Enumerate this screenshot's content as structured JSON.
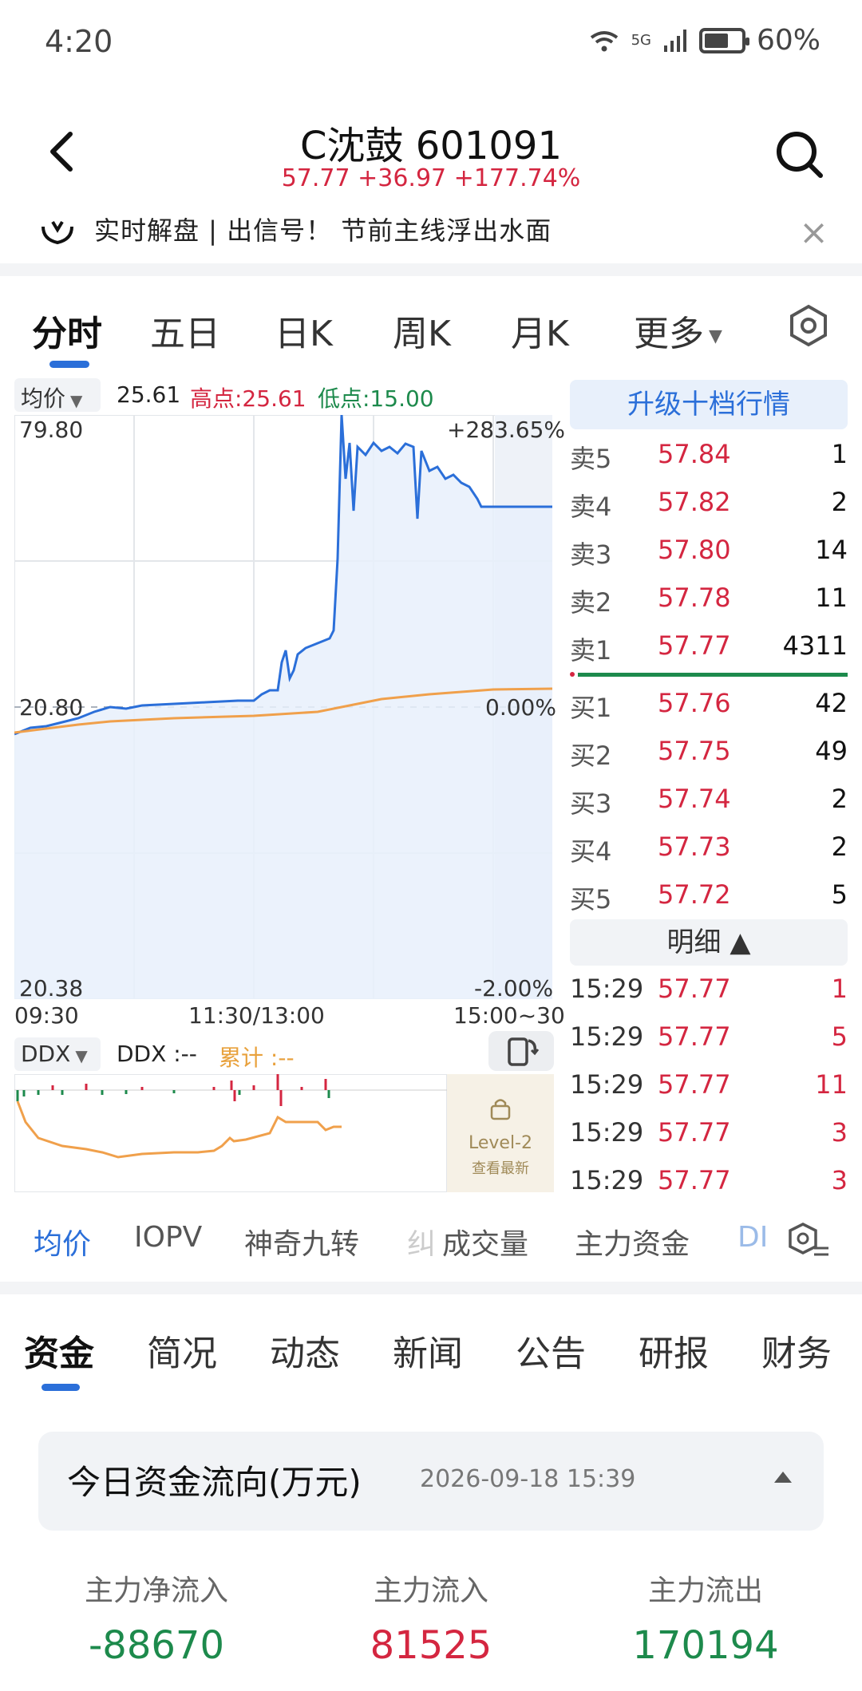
{
  "status": {
    "time": "4:20",
    "network": "5G",
    "battery": "60%"
  },
  "header": {
    "title": "C沈鼓 601091",
    "quote": "57.77 +36.97 +177.74%"
  },
  "banner": {
    "text": "实时解盘 | 出信号！ 节前主线浮出水面",
    "close": "×"
  },
  "period_tabs": [
    "分时",
    "五日",
    "日K",
    "周K",
    "月K",
    "更多"
  ],
  "price_panel": {
    "avg_label": "均价",
    "avg_value": "25.61",
    "high": "高点:25.61",
    "low": "低点:15.00",
    "axis_top_left": "79.80",
    "axis_top_right": "+283.65%",
    "axis_mid_left": "20.80",
    "axis_mid_right": "0.00%",
    "axis_bot_left": "20.38",
    "axis_bot_right": "-2.00%",
    "time_start": "09:30",
    "time_mid": "11:30/13:00",
    "time_end": "15:00~30"
  },
  "ddx_panel": {
    "label": "DDX",
    "value": "DDX :--",
    "cumulative": "累计 :--",
    "level2_title": "Level-2",
    "level2_sub": "查看最新"
  },
  "order_book": {
    "upgrade_label": "升级十档行情",
    "asks": [
      {
        "label": "卖5",
        "price": "57.84",
        "volume": "1"
      },
      {
        "label": "卖4",
        "price": "57.82",
        "volume": "2"
      },
      {
        "label": "卖3",
        "price": "57.80",
        "volume": "14"
      },
      {
        "label": "卖2",
        "price": "57.78",
        "volume": "11"
      },
      {
        "label": "卖1",
        "price": "57.77",
        "volume": "4311"
      }
    ],
    "bids": [
      {
        "label": "买1",
        "price": "57.76",
        "volume": "42"
      },
      {
        "label": "买2",
        "price": "57.75",
        "volume": "49"
      },
      {
        "label": "买3",
        "price": "57.74",
        "volume": "2"
      },
      {
        "label": "买4",
        "price": "57.73",
        "volume": "2"
      },
      {
        "label": "买5",
        "price": "57.72",
        "volume": "5"
      }
    ],
    "detail_label": "明细 ▲",
    "ticks": [
      {
        "time": "15:29",
        "price": "57.77",
        "volume": "1"
      },
      {
        "time": "15:29",
        "price": "57.77",
        "volume": "5"
      },
      {
        "time": "15:29",
        "price": "57.77",
        "volume": "11"
      },
      {
        "time": "15:29",
        "price": "57.77",
        "volume": "3"
      },
      {
        "time": "15:29",
        "price": "57.77",
        "volume": "3"
      }
    ]
  },
  "indicator_tabs": [
    "均价",
    "IOPV",
    "神奇九转",
    "纠",
    "成交量",
    "主力资金",
    "DI"
  ],
  "lower_tabs": [
    "资金",
    "简况",
    "动态",
    "新闻",
    "公告",
    "研报",
    "财务"
  ],
  "fund_flow": {
    "title": "今日资金流向(万元)",
    "timestamp": "2026-09-18 15:39",
    "columns": [
      {
        "label": "主力净流入",
        "value": "-88670"
      },
      {
        "label": "主力流入",
        "value": "81525"
      },
      {
        "label": "主力流出",
        "value": "170194"
      }
    ]
  },
  "colors": {
    "up": "#d42640",
    "down": "#1d8a4c",
    "accent": "#2b6fd9",
    "avg_line": "#f0a04b"
  },
  "icons": [
    "back-arrow-icon",
    "search-icon",
    "lightbulb-icon",
    "close-icon",
    "settings-hexagon-icon",
    "dropdown-triangle-icon",
    "rotate-screen-icon",
    "lock-icon"
  ]
}
